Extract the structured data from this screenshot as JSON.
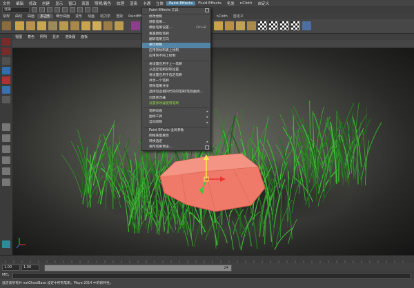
{
  "menubar": {
    "items": [
      "文件",
      "编辑",
      "修改",
      "创建",
      "显示",
      "窗口",
      "资源",
      "照明/着色",
      "纹理",
      "渲染",
      "卡通",
      "立体",
      "Paint Effects",
      "Fluid Effects",
      "毛发",
      "nCloth",
      "自定义"
    ],
    "active_index": 12
  },
  "status_line": {
    "mode_set": "渲染"
  },
  "shelf_tabs": {
    "items": [
      "常规",
      "曲线",
      "曲面",
      "多边形",
      "细分曲面",
      "变形",
      "动画",
      "动力学",
      "渲染",
      "PaintEffects",
      "卡通",
      "肌肉",
      "流体",
      "毛发",
      "头发",
      "nCloth",
      "自定义"
    ],
    "active_index": 3
  },
  "panel_menu": {
    "items": [
      "视图",
      "着色",
      "照明",
      "显示",
      "渲染器",
      "面板"
    ]
  },
  "paint_effects_menu": {
    "header": "Paint Effects 工具",
    "items": [
      {
        "label": "修改绘制",
        "shortcut": ""
      },
      {
        "label": "获取笔刷...",
        "shortcut": ""
      },
      {
        "label": "模板笔刷设置...",
        "shortcut": "Ctrl+B"
      },
      {
        "label": "重置模板笔刷",
        "shortcut": ""
      },
      {
        "label": "翻转笔刷方向",
        "shortcut": ""
      },
      {
        "label": "使可绘制",
        "shortcut": ""
      },
      {
        "label": "应用到绘制表上绘制",
        "shortcut": ""
      },
      {
        "label": "应用到不同上绘制",
        "shortcut": ""
      },
      {
        "label": "将设置应用于上一笔刷",
        "shortcut": ""
      },
      {
        "label": "从选定笔刷获取设置",
        "shortcut": ""
      },
      {
        "label": "将设置应用于选定笔刷",
        "shortcut": ""
      },
      {
        "label": "共享一个笔刷",
        "shortcut": ""
      },
      {
        "label": "移除笔刷共享",
        "shortcut": ""
      },
      {
        "label": "选择包含相同代码的笔刷/笔划曲线...",
        "shortcut": ""
      },
      {
        "label": "创建修改器",
        "shortcut": ""
      },
      {
        "label": "设置修改器使用笔刷",
        "shortcut": ""
      },
      {
        "label": "笔刷动画",
        "shortcut": ""
      },
      {
        "label": "曲线工具",
        "shortcut": ""
      },
      {
        "label": "自动绘制",
        "shortcut": ""
      },
      {
        "label": "Paint Effects 全局参数",
        "shortcut": ""
      },
      {
        "label": "网格质量属性",
        "shortcut": ""
      },
      {
        "label": "转换选定",
        "shortcut": ""
      },
      {
        "label": "保存笔刷预设...",
        "shortcut": ""
      }
    ],
    "highlighted_index": 5,
    "green_index": 15
  },
  "range": {
    "start": "1.00",
    "current": "1.00",
    "slider_label": "24"
  },
  "mel": {
    "label": "MEL"
  },
  "help_line": "选定该所有并 notGhostBase 设定中所有笔刷。Maya 2014 中的新特性。",
  "colors": {
    "menu_highlight": "#5285a6",
    "grass": "#5fb24a",
    "box": "#f07a6a",
    "viewport": "#5a5a54"
  }
}
